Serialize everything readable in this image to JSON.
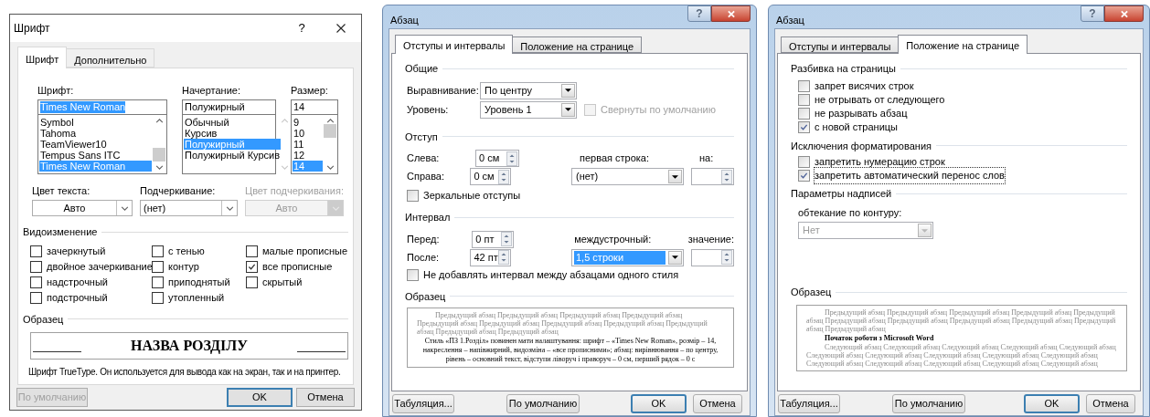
{
  "font_dialog": {
    "title": "Шрифт",
    "help": "?",
    "tabs": [
      {
        "label": "Шрифт",
        "selected": true
      },
      {
        "label": "Дополнительно",
        "selected": false
      }
    ],
    "font": {
      "label": "Шрифт:",
      "value": "Times New Roman",
      "value_selected": true,
      "items": [
        {
          "label": "Symbol",
          "selected": false
        },
        {
          "label": "Tahoma",
          "selected": false
        },
        {
          "label": "TeamViewer10",
          "selected": false
        },
        {
          "label": "Tempus Sans ITC",
          "selected": false
        },
        {
          "label": "Times New Roman",
          "selected": true
        }
      ]
    },
    "style": {
      "label": "Начертание:",
      "value": "Полужирный",
      "items": [
        {
          "label": "Обычный",
          "selected": false
        },
        {
          "label": "Курсив",
          "selected": false
        },
        {
          "label": "Полужирный",
          "selected": true
        },
        {
          "label": "Полужирный Курсив",
          "selected": false
        }
      ]
    },
    "size": {
      "label": "Размер:",
      "value": "14",
      "items": [
        {
          "label": "9",
          "selected": false
        },
        {
          "label": "10",
          "selected": false
        },
        {
          "label": "11",
          "selected": false
        },
        {
          "label": "12",
          "selected": false
        },
        {
          "label": "14",
          "selected": true
        }
      ]
    },
    "text_color": {
      "label": "Цвет текста:",
      "value": "Авто",
      "disabled": false
    },
    "underline": {
      "label": "Подчеркивание:",
      "value": "(нет)",
      "disabled": false
    },
    "underline_color": {
      "label": "Цвет подчеркивания:",
      "value": "Авто",
      "disabled": true
    },
    "effects": {
      "title": "Видоизменение",
      "items": [
        {
          "label": "зачеркнутый",
          "checked": false
        },
        {
          "label": "с тенью",
          "checked": false
        },
        {
          "label": "малые прописные",
          "checked": false
        },
        {
          "label": "двойное зачеркивание",
          "checked": false
        },
        {
          "label": "контур",
          "checked": false
        },
        {
          "label": "все прописные",
          "checked": true
        },
        {
          "label": "надстрочный",
          "checked": false
        },
        {
          "label": "приподнятый",
          "checked": false
        },
        {
          "label": "скрытый",
          "checked": false
        },
        {
          "label": "подстрочный",
          "checked": false
        },
        {
          "label": "утопленный",
          "checked": false
        }
      ]
    },
    "sample": {
      "title": "Образец",
      "text": "НАЗВА РОЗДІЛУ",
      "note": "Шрифт TrueType. Он используется для вывода как на экран, так и на принтер."
    },
    "buttons": [
      {
        "label": "По умолчанию",
        "disabled": true,
        "focused": false
      },
      {
        "label": "OK",
        "disabled": false,
        "focused": true
      },
      {
        "label": "Отмена",
        "disabled": false,
        "focused": false
      }
    ]
  },
  "paragraph_indents": {
    "title": "Абзац",
    "help": "?",
    "tabs": [
      {
        "label": "Отступы и интервалы",
        "selected": true
      },
      {
        "label": "Положение на странице",
        "selected": false
      }
    ],
    "general": {
      "title": "Общие",
      "alignment": {
        "label": "Выравнивание:",
        "value": "По центру",
        "selected": false
      },
      "level": {
        "label": "Уровень:",
        "value": "Уровень 1",
        "selected": false
      },
      "collapsed": {
        "label": "Свернуты по умолчанию",
        "checked": false,
        "disabled": true
      }
    },
    "indent": {
      "title": "Отступ",
      "left": {
        "label": "Слева:",
        "value": "0 см"
      },
      "right": {
        "label": "Справа:",
        "value": "0 см"
      },
      "first_line": {
        "label": "первая строка:",
        "value": "(нет)",
        "selected": false
      },
      "by": {
        "label": "на:"
      },
      "mirror": {
        "label": "Зеркальные отступы",
        "checked": false,
        "disabled": false
      }
    },
    "spacing": {
      "title": "Интервал",
      "before": {
        "label": "Перед:",
        "value": "0 пт"
      },
      "after": {
        "label": "После:",
        "value": "42 пт"
      },
      "line_spacing": {
        "label": "междустрочный:",
        "value": "1,5 строки",
        "selected": true
      },
      "at": {
        "label": "значение:"
      },
      "no_space": {
        "label": "Не добавлять интервал между абзацами одного стиля",
        "checked": false,
        "disabled": false
      }
    },
    "preview": {
      "title": "Образец",
      "previous": "Предыдущий абзац Предыдущий абзац Предыдущий абзац Предыдущий абзац Предыдущий абзац Предыдущий абзац Предыдущий абзац Предыдущий абзац Предыдущий абзац Предыдущий абзац Предыдущий абзац",
      "sample": "Стиль «ПЗ 1.Розділ» повинен мати налаштування: шрифт – «Times New Roman», розмір – 14, накреслення – напівжирний, видозміна – «все прописними»; абзац: вирівнювання – по центру, рівень – основний текст, відступи ліворуч і праворуч – 0 см, перший рядок – 0 с"
    },
    "buttons": [
      {
        "label": "Табуляция...",
        "disabled": false,
        "focused": false
      },
      {
        "label": "По умолчанию",
        "disabled": false,
        "focused": false
      },
      {
        "label": "OK",
        "disabled": false,
        "focused": true
      },
      {
        "label": "Отмена",
        "disabled": false,
        "focused": false
      }
    ]
  },
  "paragraph_position": {
    "title": "Абзац",
    "help": "?",
    "tabs": [
      {
        "label": "Отступы и интервалы",
        "selected": false
      },
      {
        "label": "Положение на странице",
        "selected": true
      }
    ],
    "pagination": {
      "title": "Разбивка на страницы",
      "items": [
        {
          "label": "запрет висячих строк",
          "checked": false,
          "focused": false
        },
        {
          "label": "не отрывать от следующего",
          "checked": false,
          "focused": false
        },
        {
          "label": "не разрывать абзац",
          "checked": false,
          "focused": false
        },
        {
          "label": "с новой страницы",
          "checked": true,
          "focused": false
        }
      ]
    },
    "exceptions": {
      "title": "Исключения форматирования",
      "items": [
        {
          "label": "запретить нумерацию строк",
          "checked": false,
          "focused": false
        },
        {
          "label": "запретить автоматический перенос слов",
          "checked": true,
          "focused": true
        }
      ]
    },
    "textbox": {
      "title": "Параметры надписей",
      "wrap": {
        "label": "обтекание по контуру:",
        "value": "Нет",
        "disabled": true
      }
    },
    "preview": {
      "title": "Образец",
      "previous": "Предыдущий абзац Предыдущий абзац Предыдущий абзац Предыдущий абзац Предыдущий абзац Предыдущий абзац Предыдущий абзац Предыдущий абзац Предыдущий абзац Предыдущий абзац Предыдущий абзац",
      "sample": "Початок роботи з Microsoft Word",
      "next": "Следующий абзац Следующий абзац Следующий абзац Следующий абзац Следующий абзац Следующий абзац Следующий абзац Следующий абзац Следующий абзац Следующий абзац Следующий абзац Следующий абзац Следующий абзац Следующий абзац Следующий абзац"
    },
    "buttons": [
      {
        "label": "Табуляция...",
        "disabled": false,
        "focused": false
      },
      {
        "label": "По умолчанию",
        "disabled": false,
        "focused": false
      },
      {
        "label": "OK",
        "disabled": false,
        "focused": true
      },
      {
        "label": "Отмена",
        "disabled": false,
        "focused": false
      }
    ]
  }
}
